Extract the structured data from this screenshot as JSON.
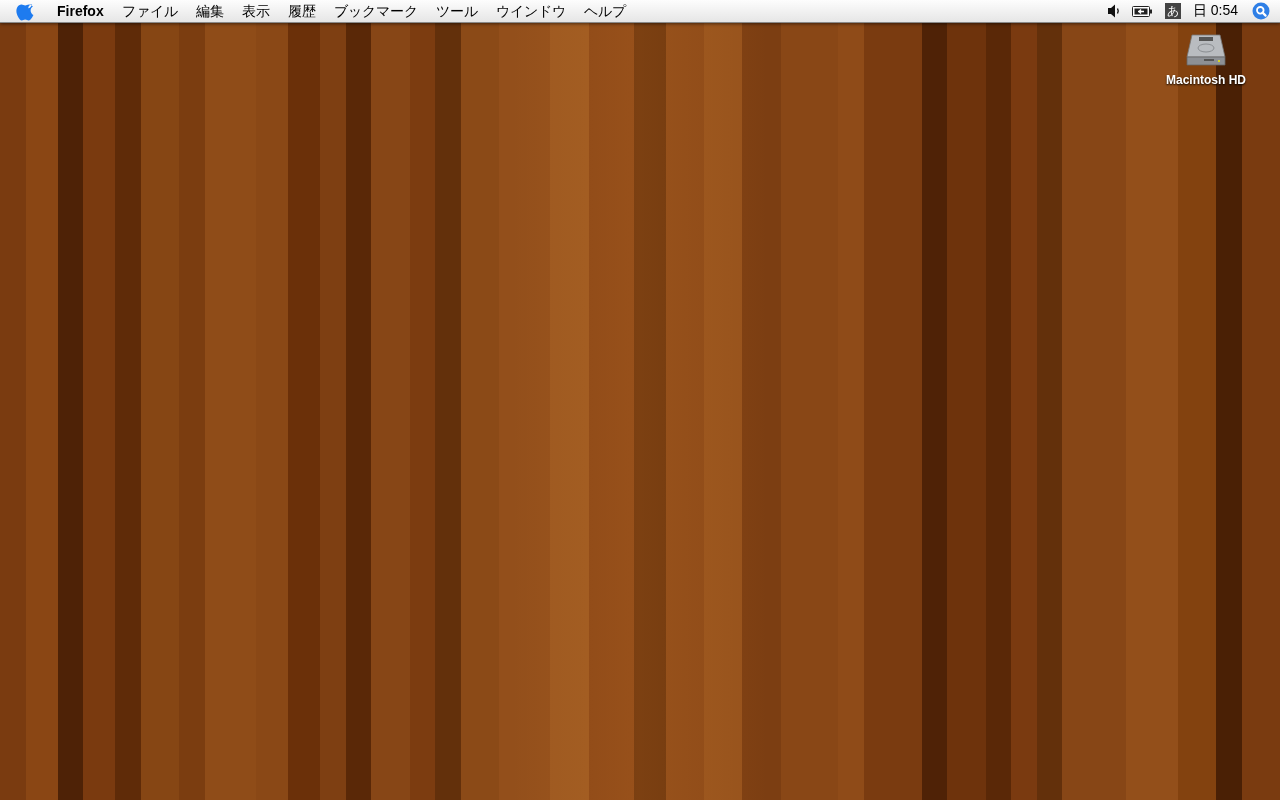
{
  "menubar": {
    "app_name": "Firefox",
    "menus": [
      "ファイル",
      "編集",
      "表示",
      "履歴",
      "ブックマーク",
      "ツール",
      "ウインドウ",
      "ヘルプ"
    ],
    "input_method": "あ",
    "clock": "日 0:54"
  },
  "desktop": {
    "icons": [
      {
        "label": "Macintosh HD"
      }
    ]
  }
}
